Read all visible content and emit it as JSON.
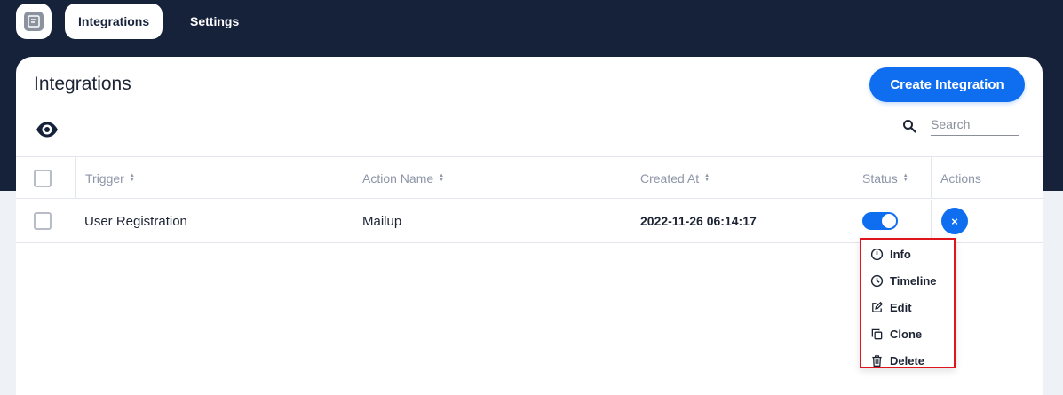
{
  "nav": {
    "tabs": [
      {
        "label": "Integrations",
        "active": true
      },
      {
        "label": "Settings",
        "active": false
      }
    ]
  },
  "page": {
    "title": "Integrations",
    "create_button": "Create Integration",
    "search_placeholder": "Search"
  },
  "table": {
    "columns": [
      "Trigger",
      "Action Name",
      "Created At",
      "Status",
      "Actions"
    ],
    "rows": [
      {
        "trigger": "User Registration",
        "action_name": "Mailup",
        "created_at": "2022-11-26 06:14:17",
        "status_enabled": true
      }
    ]
  },
  "actions_menu": {
    "close_symbol": "×",
    "items": [
      {
        "label": "Info",
        "icon": "info-circle-icon"
      },
      {
        "label": "Timeline",
        "icon": "clock-icon"
      },
      {
        "label": "Edit",
        "icon": "edit-icon"
      },
      {
        "label": "Clone",
        "icon": "clone-icon"
      },
      {
        "label": "Delete",
        "icon": "trash-icon"
      }
    ]
  },
  "colors": {
    "header_bg": "#16223a",
    "primary": "#0f6ef0",
    "highlight": "#e0141c"
  }
}
